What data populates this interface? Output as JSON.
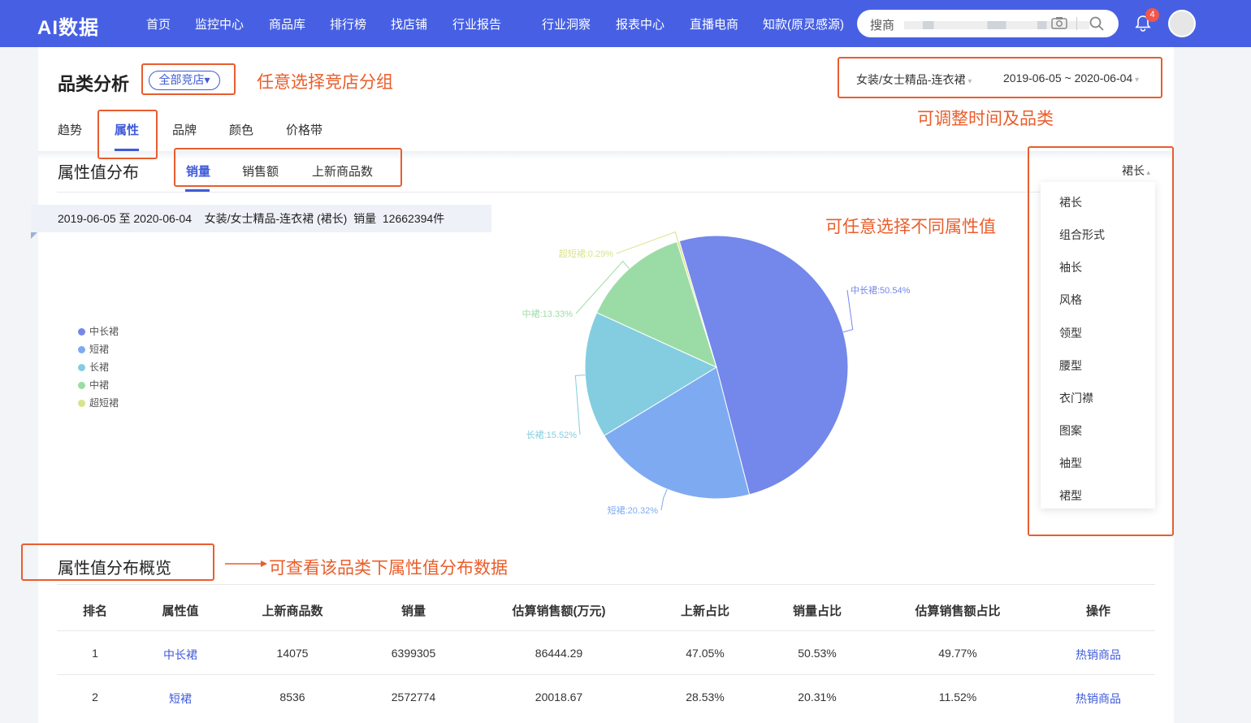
{
  "header": {
    "logo": "AI数据",
    "nav": [
      "首页",
      "监控中心",
      "商品库",
      "排行榜",
      "找店铺",
      "行业报告",
      "行业洞察",
      "报表中心",
      "直播电商",
      "知款(原灵感源)"
    ],
    "search_placeholder": "搜商",
    "notification_count": "4",
    "brand_color": "#4760e3"
  },
  "page": {
    "title": "品类分析",
    "group_chip": "全部竞店▾",
    "category_filter": "女装/女士精品-连衣裙",
    "date_range": "2019-06-05 ~ 2020-06-04",
    "tabs": [
      "趋势",
      "属性",
      "品牌",
      "颜色",
      "价格带"
    ],
    "active_tab": "属性"
  },
  "distribution": {
    "title": "属性值分布",
    "metric_tabs": [
      "销量",
      "销售额",
      "上新商品数"
    ],
    "active_metric": "销量",
    "attribute_selector": "裙长",
    "info_line": "2019-06-05 至 2020-06-04    女装/女士精品-连衣裙 (裙长)  销量  12662394件",
    "dropdown_options": [
      "裙长",
      "组合形式",
      "袖长",
      "风格",
      "领型",
      "腰型",
      "衣门襟",
      "图案",
      "袖型",
      "裙型"
    ]
  },
  "chart_data": {
    "type": "pie",
    "slices": [
      {
        "name": "中长裙",
        "value": 50.54,
        "label": "中长裙:50.54%",
        "color": "#7487ea"
      },
      {
        "name": "短裙",
        "value": 20.32,
        "label": "短裙:20.32%",
        "color": "#7eaaf1"
      },
      {
        "name": "长裙",
        "value": 15.52,
        "label": "长裙:15.52%",
        "color": "#84cde0"
      },
      {
        "name": "中裙",
        "value": 13.33,
        "label": "中裙:13.33%",
        "color": "#9bdca6"
      },
      {
        "name": "超短裙",
        "value": 0.29,
        "label": "超短裙:0.29%",
        "color": "#d9e38a"
      }
    ],
    "legend": [
      "中长裙",
      "短裙",
      "长裙",
      "中裙",
      "超短裙"
    ],
    "legend_position": "left"
  },
  "overview": {
    "title": "属性值分布概览",
    "columns": [
      "排名",
      "属性值",
      "上新商品数",
      "销量",
      "估算销售额(万元)",
      "上新占比",
      "销量占比",
      "估算销售额占比",
      "操作"
    ],
    "rows": [
      [
        "1",
        "中长裙",
        "14075",
        "6399305",
        "86444.29",
        "47.05%",
        "50.53%",
        "49.77%",
        "热销商品"
      ],
      [
        "2",
        "短裙",
        "8536",
        "2572774",
        "20018.67",
        "28.53%",
        "20.31%",
        "11.52%",
        "热销商品"
      ]
    ]
  },
  "annotations": {
    "group": "任意选择竞店分组",
    "time_category": "可调整时间及品类",
    "attribute": "可任意选择不同属性值",
    "overview": "可查看该品类下属性值分布数据"
  }
}
